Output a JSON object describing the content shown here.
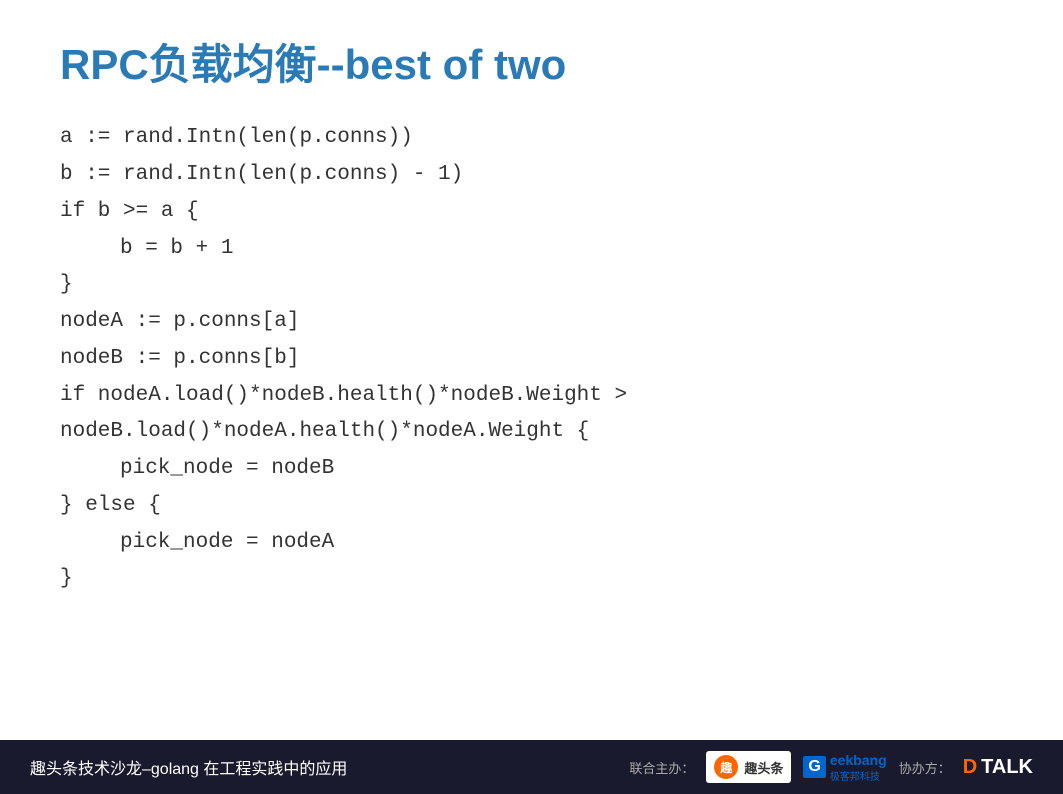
{
  "page": {
    "background": "#ffffff"
  },
  "title": {
    "text": "RPC负载均衡--best of two",
    "color": "#2a7ab5"
  },
  "code": {
    "lines": [
      {
        "id": 1,
        "text": "a := rand.Intn(len(p.conns))",
        "indent": false
      },
      {
        "id": 2,
        "text": "b := rand.Intn(len(p.conns) - 1)",
        "indent": false
      },
      {
        "id": 3,
        "text": "if b >= a {",
        "indent": false
      },
      {
        "id": 4,
        "text": "b = b + 1",
        "indent": true
      },
      {
        "id": 5,
        "text": "}",
        "indent": false
      },
      {
        "id": 6,
        "text": "nodeA := p.conns[a]",
        "indent": false
      },
      {
        "id": 7,
        "text": "nodeB := p.conns[b]",
        "indent": false
      },
      {
        "id": 8,
        "text": "if nodeA.load()*nodeB.health()*nodeB.Weight >",
        "indent": false
      },
      {
        "id": 9,
        "text": "nodeB.load()*nodeA.health()*nodeA.Weight {",
        "indent": false
      },
      {
        "id": 10,
        "text": "pick_node = nodeB",
        "indent": true
      },
      {
        "id": 11,
        "text": "} else {",
        "indent": false
      },
      {
        "id": 12,
        "text": "pick_node = nodeA",
        "indent": true
      },
      {
        "id": 13,
        "text": "}",
        "indent": false
      }
    ]
  },
  "footer": {
    "left_text": "趣头条技术沙龙–golang 在工程实践中的应用",
    "co_organizer_label": "联合主办：",
    "organizer_label": "协办方：",
    "toutiao_name": "趣头条",
    "geekbang_name": "Geekbang",
    "geekbang_sub": "极客邦科技",
    "dtalk_name": "DTALK"
  }
}
